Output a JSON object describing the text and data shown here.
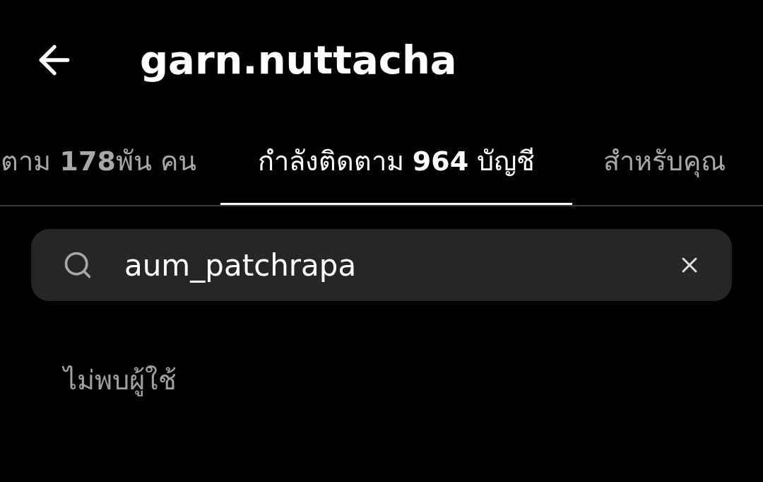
{
  "header": {
    "title": "garn.nuttacha"
  },
  "tabs": [
    {
      "label": "ตาม **178**พัน คน",
      "selected": false
    },
    {
      "label": "กำลังติดตาม **964** บัญชี",
      "selected": true
    },
    {
      "label": "สำหรับคุณ",
      "selected": false
    }
  ],
  "search": {
    "value": "aum_patchrapa"
  },
  "message": "ไม่พบผู้ใช้"
}
